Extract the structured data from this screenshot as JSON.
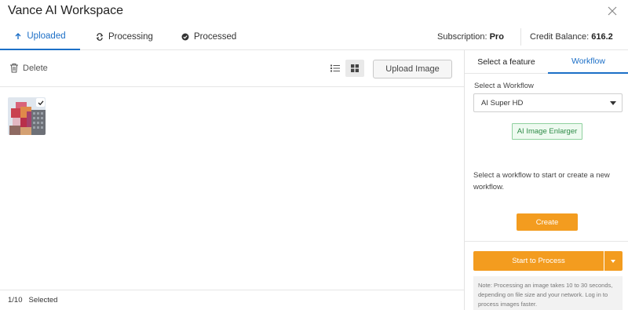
{
  "window": {
    "title": "Vance AI Workspace"
  },
  "tabs": [
    {
      "label": "Uploaded",
      "icon": "upload-arrow-icon"
    },
    {
      "label": "Processing",
      "icon": "refresh-icon"
    },
    {
      "label": "Processed",
      "icon": "check-circle-icon"
    }
  ],
  "account": {
    "subscription_label": "Subscription:",
    "subscription_value": "Pro",
    "credit_label": "Credit Balance:",
    "credit_value": "616.2"
  },
  "toolbar": {
    "delete_label": "Delete",
    "upload_label": "Upload Image",
    "view_modes": [
      "list-view-icon",
      "grid-view-icon"
    ],
    "selected_view": "grid-view-icon"
  },
  "images": [
    {
      "selected": true
    }
  ],
  "footer": {
    "count": "1/10",
    "status": "Selected"
  },
  "panel": {
    "tabs": [
      "Select a feature",
      "Workflow"
    ],
    "active_tab": "Workflow",
    "select_label": "Select a Workflow",
    "selected_workflow": "AI Super HD",
    "workflow_steps": [
      "AI Image Enlarger"
    ],
    "hint": "Select a workflow to start or create a new workflow.",
    "create_label": "Create",
    "start_label": "Start to Process",
    "note": "Note: Processing an image takes 10 to 30 seconds, depending on file size and your network. Log in to process images faster."
  },
  "colors": {
    "accent": "#1c6fc7",
    "primary_button": "#f39c1f",
    "tag_border": "#8fd19e",
    "tag_text": "#2e8b47"
  }
}
